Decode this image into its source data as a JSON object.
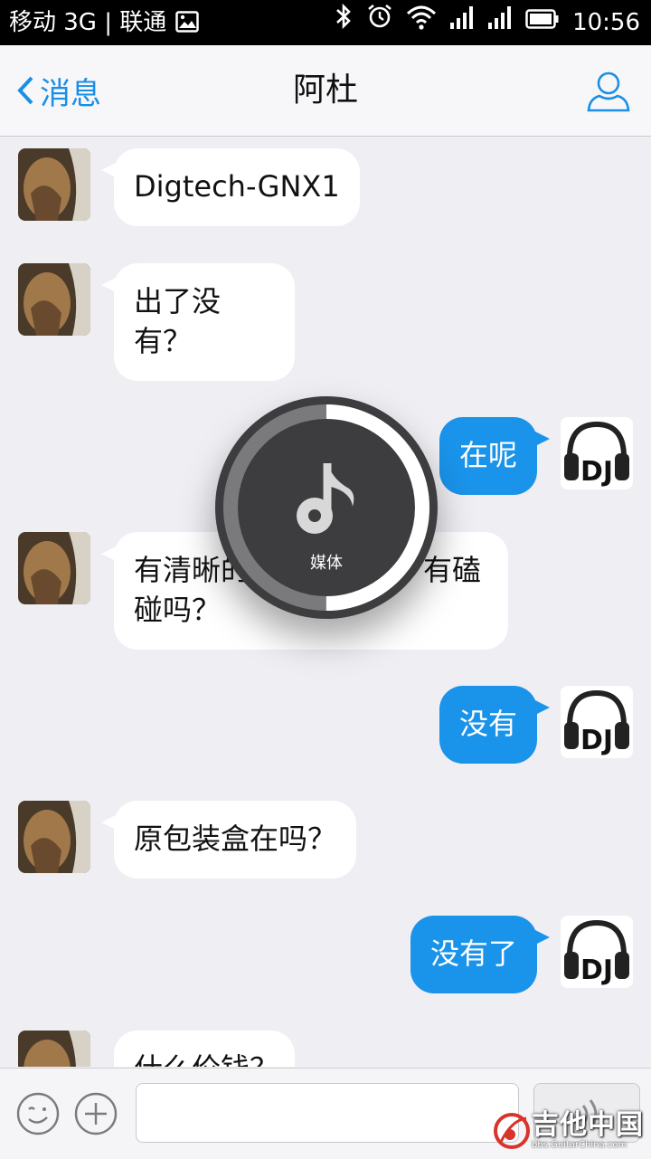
{
  "status_bar": {
    "carrier": "移动 3G | 联通",
    "time": "10:56"
  },
  "nav": {
    "back_label": "消息",
    "title": "阿杜"
  },
  "messages": [
    {
      "from": "them",
      "text": "Digtech-GNX1"
    },
    {
      "from": "them",
      "text": "出了没有？"
    },
    {
      "from": "me",
      "text": "在呢"
    },
    {
      "from": "them",
      "text": "有清晰的图片看看吗？有磕碰吗？"
    },
    {
      "from": "me",
      "text": "没有"
    },
    {
      "from": "them",
      "text": "原包装盒在吗？"
    },
    {
      "from": "me",
      "text": "没有了"
    },
    {
      "from": "them",
      "text": "什么价钱？"
    }
  ],
  "volume_overlay": {
    "label": "媒体",
    "level": 0.5,
    "icon": "music-note-icon"
  },
  "input": {
    "value": "",
    "placeholder": ""
  },
  "watermark": {
    "main": "吉他中国",
    "sub": "bbs.GuitarChina.com"
  },
  "colors": {
    "accent": "#1a8fe6",
    "my_bubble": "#1a93ea",
    "their_bubble": "#ffffff",
    "background": "#eeeef3"
  }
}
